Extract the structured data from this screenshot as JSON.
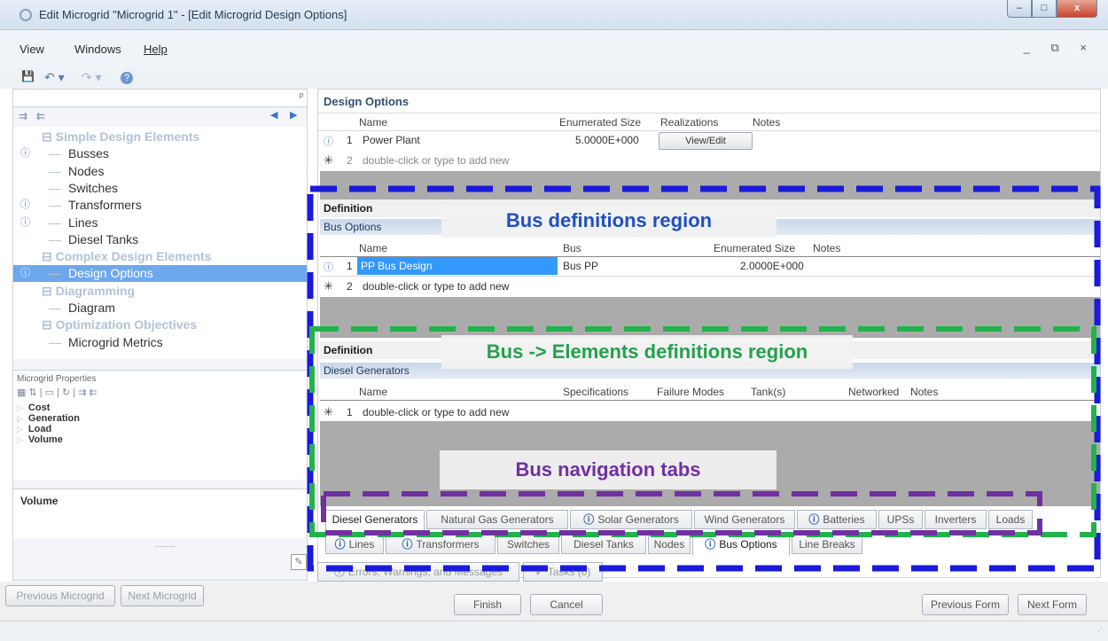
{
  "window": {
    "title": "Edit Microgrid \"Microgrid 1\" - [Edit Microgrid Design Options]",
    "min_glyph": "–",
    "max_glyph": "□",
    "close_glyph": "x",
    "mdi_controls": "_ ⧉ ×"
  },
  "menu": [
    "View",
    "Windows",
    "Help"
  ],
  "toolbar": {
    "save": "💾",
    "undo": "↶ ▾",
    "redo": "↷ ▾",
    "help": "?"
  },
  "left": {
    "pin": "ᵖ",
    "tree": [
      {
        "label": "⊟ Simple Design Elements",
        "type": "group",
        "info": false
      },
      {
        "label": "Busses",
        "type": "item",
        "info": true
      },
      {
        "label": "Nodes",
        "type": "item",
        "info": false
      },
      {
        "label": "Switches",
        "type": "item",
        "info": false
      },
      {
        "label": "Transformers",
        "type": "item",
        "info": true
      },
      {
        "label": "Lines",
        "type": "item",
        "info": true
      },
      {
        "label": "Diesel Tanks",
        "type": "item",
        "info": false
      },
      {
        "label": "⊟ Complex Design Elements",
        "type": "group",
        "info": false
      },
      {
        "label": "Design Options",
        "type": "item",
        "info": true,
        "selected": true
      },
      {
        "label": "⊟ Diagramming",
        "type": "group",
        "info": false
      },
      {
        "label": "Diagram",
        "type": "item",
        "info": false
      },
      {
        "label": "⊟ Optimization Objectives",
        "type": "group",
        "info": false
      },
      {
        "label": "Microgrid Metrics",
        "type": "item",
        "info": false
      }
    ],
    "properties": {
      "title": "Microgrid Properties",
      "categories": [
        "Cost",
        "Generation",
        "Load",
        "Volume"
      ]
    },
    "description_title": "Volume",
    "grip": "........."
  },
  "design_options": {
    "title": "Design Options",
    "columns": [
      "Name",
      "Enumerated Size",
      "Realizations",
      "Notes"
    ],
    "rows": [
      {
        "num": "1",
        "name": "Power Plant",
        "size": "5.0000E+000",
        "button": "View/Edit"
      }
    ],
    "new_row": {
      "num": "2",
      "text": "double-click or type to add new"
    }
  },
  "bus_section": {
    "definition": "Definition",
    "subtitle": "Bus Options",
    "columns": [
      "Name",
      "Bus",
      "Enumerated Size",
      "Notes"
    ],
    "rows": [
      {
        "num": "1",
        "name": "PP Bus Design",
        "bus": "Bus PP",
        "size": "2.0000E+000"
      }
    ],
    "new_row": {
      "num": "2",
      "text": "double-click or type to add new"
    }
  },
  "elements_section": {
    "definition": "Definition",
    "subtitle": "Diesel Generators",
    "columns": [
      "Name",
      "Specifications",
      "Failure Modes",
      "Tank(s)",
      "Networked",
      "Notes"
    ],
    "new_row": {
      "num": "1",
      "text": "double-click or type to add new"
    }
  },
  "tabs_row1": [
    "Diesel Generators",
    "Natural Gas Generators",
    "Solar Generators",
    "Wind Generators",
    "Batteries",
    "UPSs",
    "Inverters",
    "Loads"
  ],
  "tabs_row2": [
    "Lines",
    "Transformers",
    "Switches",
    "Diesel Tanks",
    "Nodes",
    "Bus Options",
    "Line Breaks"
  ],
  "bottom_tabs": [
    "Errors, Warnings, and Messages",
    "Tasks (0)"
  ],
  "footer": {
    "prev_microgrid": "Previous Microgrid",
    "next_microgrid": "Next Microgrid",
    "finish": "Finish",
    "cancel": "Cancel",
    "prev_form": "Previous Form",
    "next_form": "Next Form"
  },
  "callouts": {
    "bus_region": "Bus definitions region",
    "elements_region": "Bus -> Elements definitions region",
    "nav_tabs": "Bus navigation tabs"
  },
  "colors": {
    "blue_outline": "#1a1adb",
    "green_outline": "#22b24c",
    "purple_outline": "#7030a0",
    "callout_blue": "#1f4fc4",
    "callout_green": "#22a24c",
    "callout_purple": "#7030a0",
    "selection": "#6ea8ec"
  }
}
